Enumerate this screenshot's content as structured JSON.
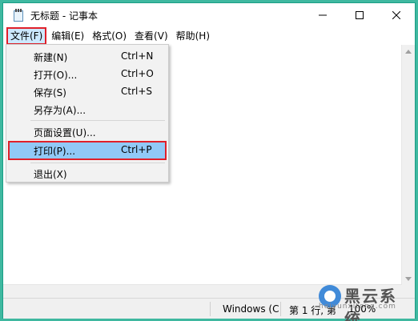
{
  "window": {
    "title": "无标题 - 记事本"
  },
  "menubar": {
    "items": [
      "文件(F)",
      "编辑(E)",
      "格式(O)",
      "查看(V)",
      "帮助(H)"
    ]
  },
  "file_menu": {
    "items": [
      {
        "label": "新建(N)",
        "shortcut": "Ctrl+N"
      },
      {
        "label": "打开(O)...",
        "shortcut": "Ctrl+O"
      },
      {
        "label": "保存(S)",
        "shortcut": "Ctrl+S"
      },
      {
        "label": "另存为(A)...",
        "shortcut": ""
      },
      {
        "label": "页面设置(U)...",
        "shortcut": ""
      },
      {
        "label": "打印(P)...",
        "shortcut": "Ctrl+P"
      },
      {
        "label": "退出(X)",
        "shortcut": ""
      }
    ]
  },
  "statusbar": {
    "encoding": "Windows (C",
    "position": "第 1 行, 第",
    "zoom": "100%"
  },
  "watermark": {
    "brand": "黑云系统",
    "url": "heiyunxitong.com"
  },
  "colors": {
    "desktop": "#3fb8a0",
    "highlight_border": "#e0202a",
    "menu_hover": "#91c9f7"
  }
}
